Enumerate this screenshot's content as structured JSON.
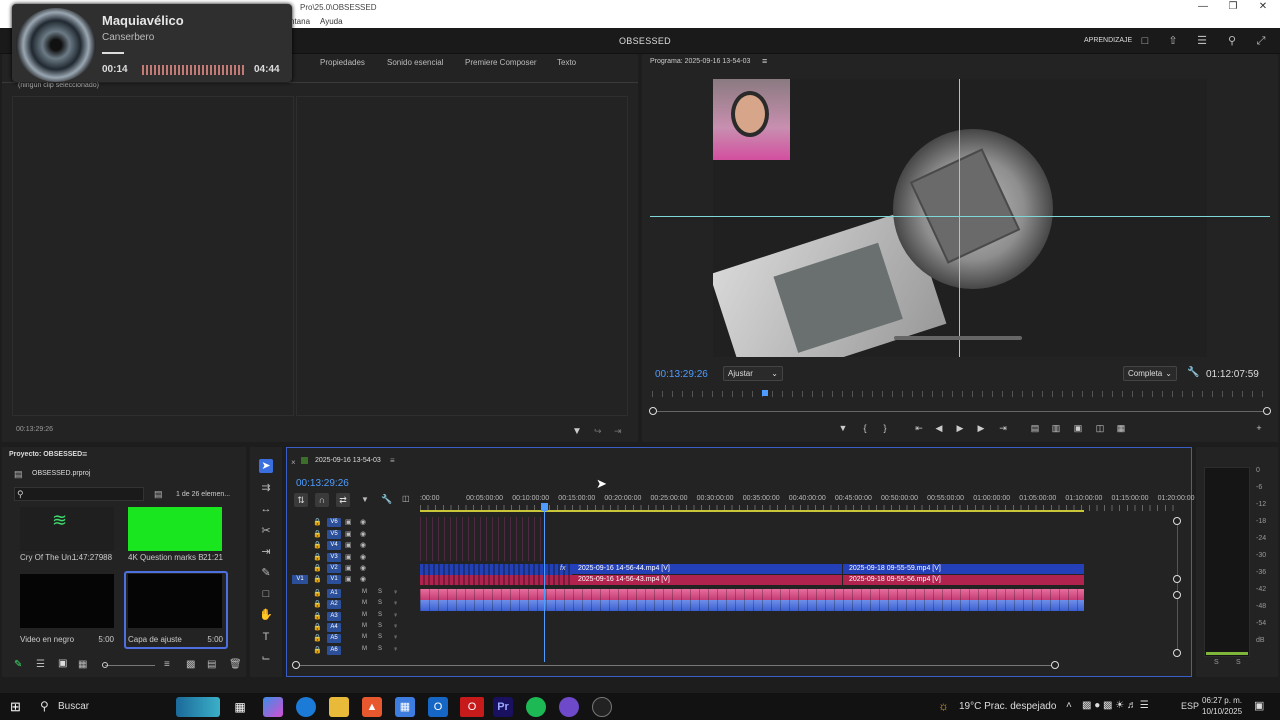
{
  "window": {
    "title": "Pro\\25.0\\OBSESSED",
    "menu": [
      "ntana",
      "Ayuda"
    ]
  },
  "header": {
    "workspace": "OBSESSED",
    "learn": "APRENDIZAJE"
  },
  "music": {
    "song": "Maquiavélico",
    "artist": "Canserbero",
    "current": "00:14",
    "total": "04:44"
  },
  "source_panel": {
    "tabs": [
      "Propiedades",
      "Sonido esencial",
      "Premiere Composer",
      "Texto"
    ],
    "no_clip": "(ningún clip seleccionado)",
    "timecode": "00:13:29:26"
  },
  "program": {
    "title": "Programa: 2025-09-16 13-54-03",
    "timecode": "00:13:29:26",
    "fit": "Ajustar",
    "quality": "Completa",
    "duration": "01:12:07:59"
  },
  "project": {
    "title": "Proyecto: OBSESSED",
    "file": "OBSESSED.prproj",
    "count": "1 de 26 elemen...",
    "items": [
      {
        "name": "Cry Of The Un...",
        "duration": "1:47:27988"
      },
      {
        "name": "4K Question marks B...",
        "duration": "21:21"
      },
      {
        "name": "Video en negro",
        "duration": "5:00"
      },
      {
        "name": "Capa de ajuste",
        "duration": "5:00"
      }
    ]
  },
  "timeline": {
    "sequence": "2025-09-16 13-54-03",
    "timecode": "00:13:29:26",
    "ruler": [
      ":00:00",
      "00:05:00:00",
      "00:10:00:00",
      "00:15:00:00",
      "00:20:00:00",
      "00:25:00:00",
      "00:30:00:00",
      "00:35:00:00",
      "00:40:00:00",
      "00:45:00:00",
      "00:50:00:00",
      "00:55:00:00",
      "01:00:00:00",
      "01:05:00:00",
      "01:10:00:00",
      "01:15:00:00",
      "01:20:00:00"
    ],
    "video_tracks": [
      "V6",
      "V5",
      "V4",
      "V3",
      "V2",
      "V1"
    ],
    "audio_tracks": [
      "A1",
      "A2",
      "A3",
      "A4",
      "A5",
      "A6"
    ],
    "source_patch": "V1",
    "clips": [
      {
        "label": "2025-09-16 14-56-44.mp4 [V]",
        "track": "V2"
      },
      {
        "label": "2025-09-18 09-55-59.mp4 [V]",
        "track": "V2"
      },
      {
        "label": "2025-09-16 14-56-43.mp4 [V]",
        "track": "V1"
      },
      {
        "label": "2025-09-18 09-55-56.mp4 [V]",
        "track": "V1"
      }
    ],
    "track_m": "M",
    "track_s": "S"
  },
  "meter": {
    "scale": [
      "0",
      "-6",
      "-12",
      "-18",
      "-24",
      "-30",
      "-36",
      "-42",
      "-48",
      "-54",
      "dB"
    ],
    "s1": "S",
    "s2": "S"
  },
  "taskbar": {
    "search": "Buscar",
    "weather": "19°C  Prac. despejado",
    "lang": "ESP",
    "time": "06:27 p. m.",
    "date": "10/10/2025"
  },
  "colors": {
    "accent": "#4e9cff",
    "clip_video": "#2340b8",
    "clip_audio": "#b1234f",
    "playhead": "#4e9cff"
  }
}
